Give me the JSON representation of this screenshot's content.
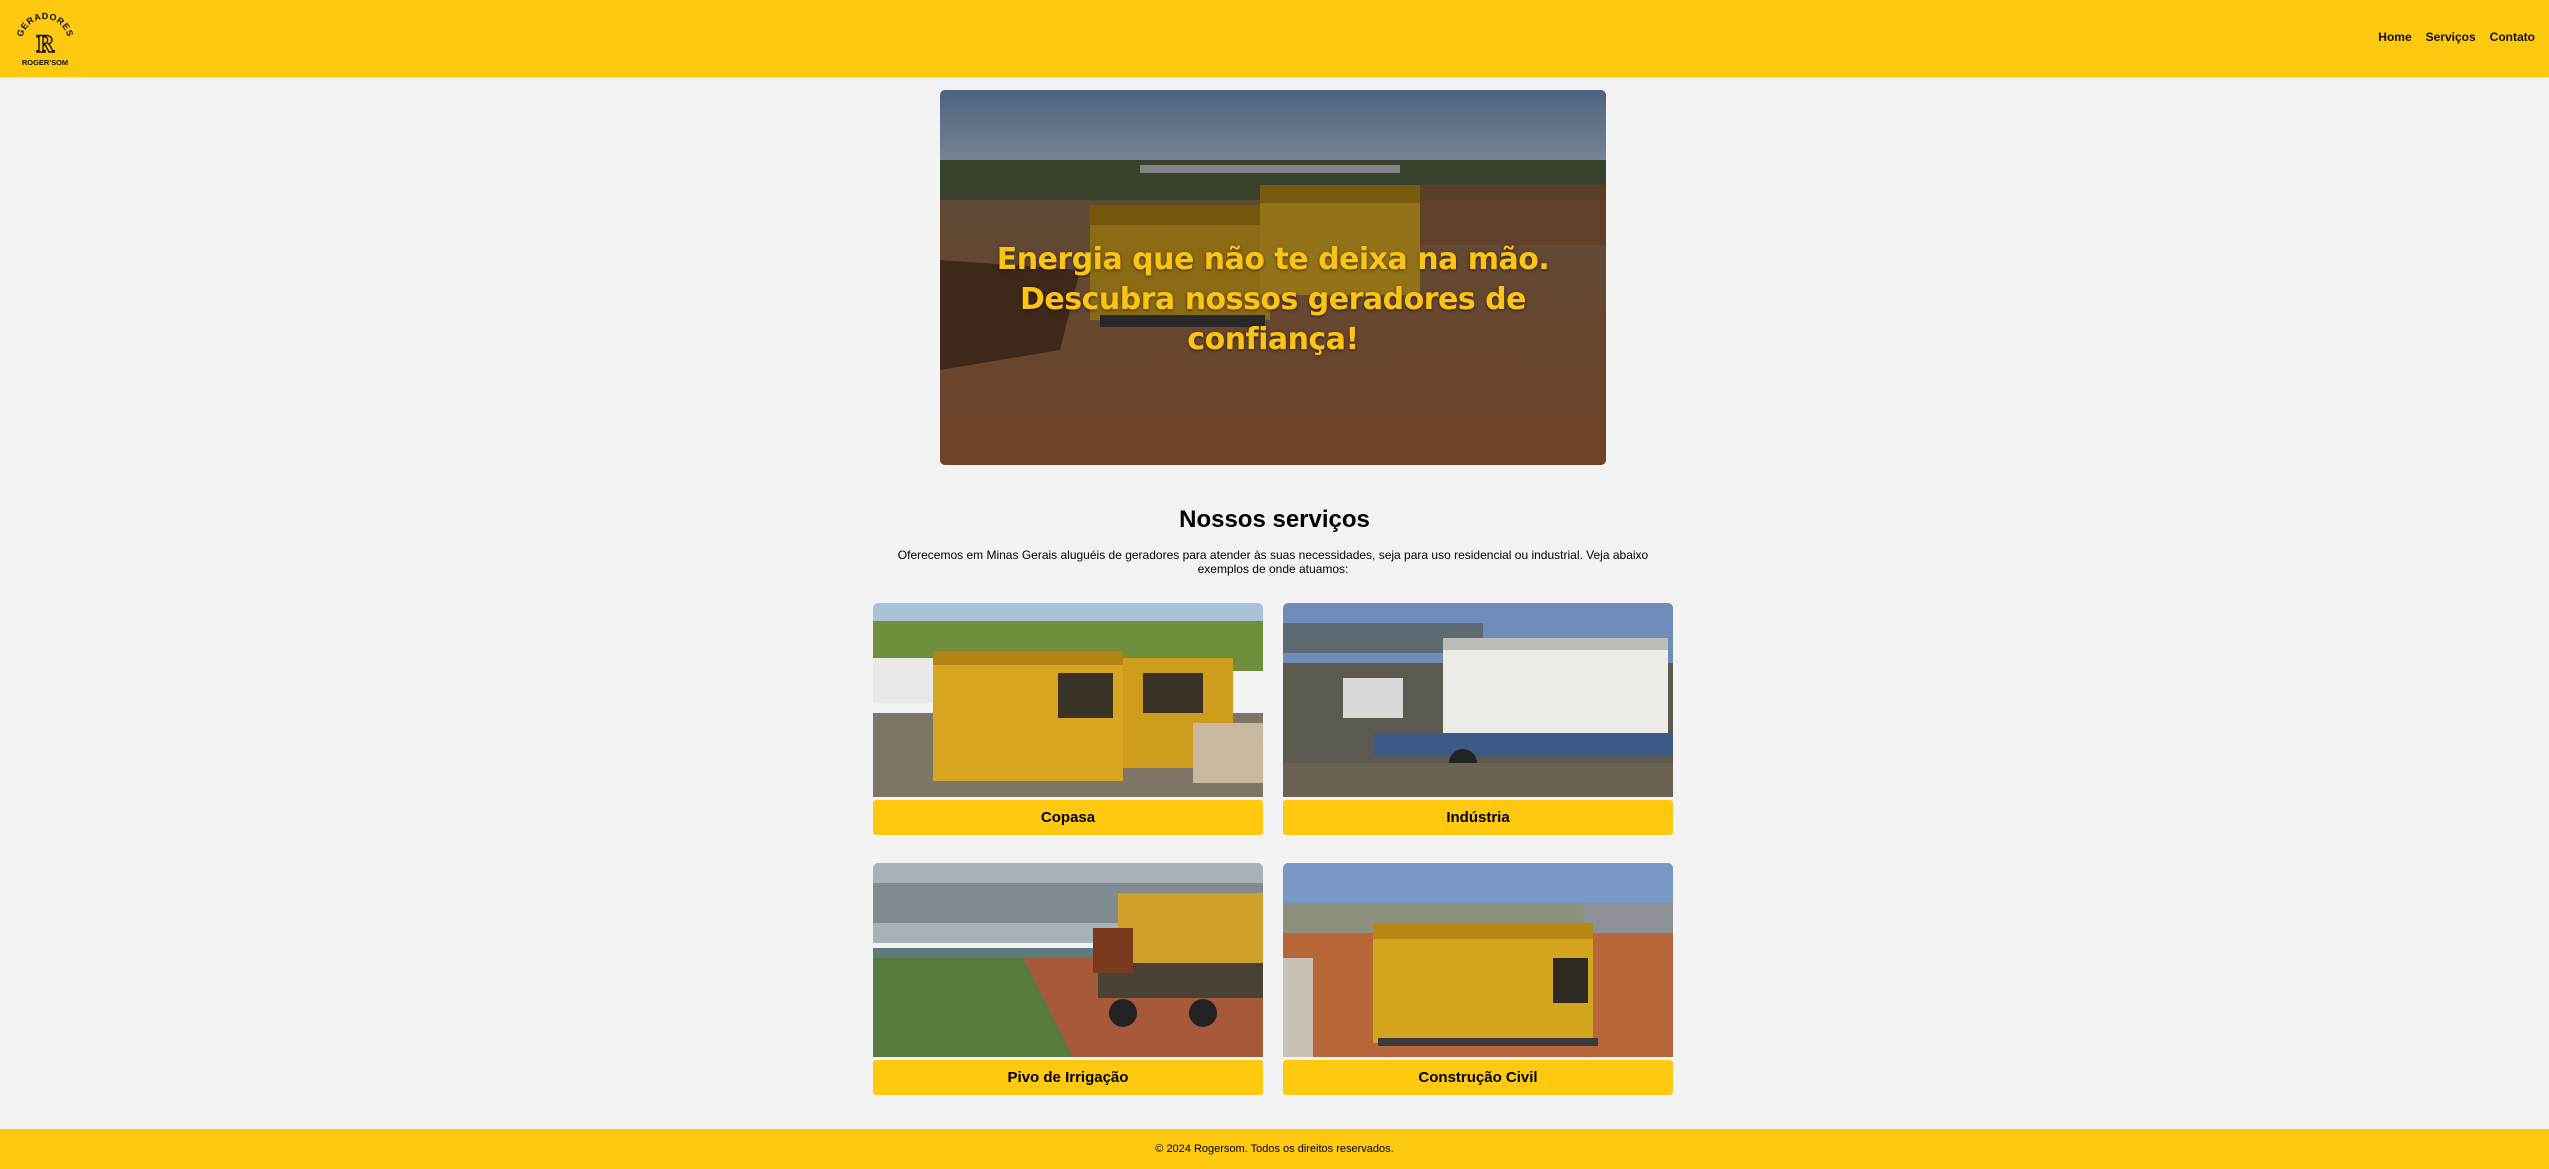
{
  "brand": {
    "logo_top_text": "GERADORES",
    "logo_letter": "R",
    "logo_bottom_text": "ROGER'SOM"
  },
  "nav": {
    "items": [
      {
        "label": "Home"
      },
      {
        "label": "Serviços"
      },
      {
        "label": "Contato"
      }
    ]
  },
  "hero": {
    "headline": "Energia que não te deixa na mão. Descubra nossos geradores de confiança!"
  },
  "services": {
    "title": "Nossos serviços",
    "description": "Oferecemos em Minas Gerais aluguéis de geradores para atender às suas necessidades, seja para uso residencial ou industrial. Veja abaixo exemplos de onde atuamos:",
    "cards": [
      {
        "label": "Copasa"
      },
      {
        "label": "Indústria"
      },
      {
        "label": "Pivo de Irrigação"
      },
      {
        "label": "Construção Civil"
      }
    ]
  },
  "footer": {
    "text": "© 2024 Rogersom. Todos os direitos reservados."
  },
  "colors": {
    "brand_yellow": "#fec90f",
    "page_background": "#f3f3f3",
    "hero_text": "#fdc414"
  }
}
